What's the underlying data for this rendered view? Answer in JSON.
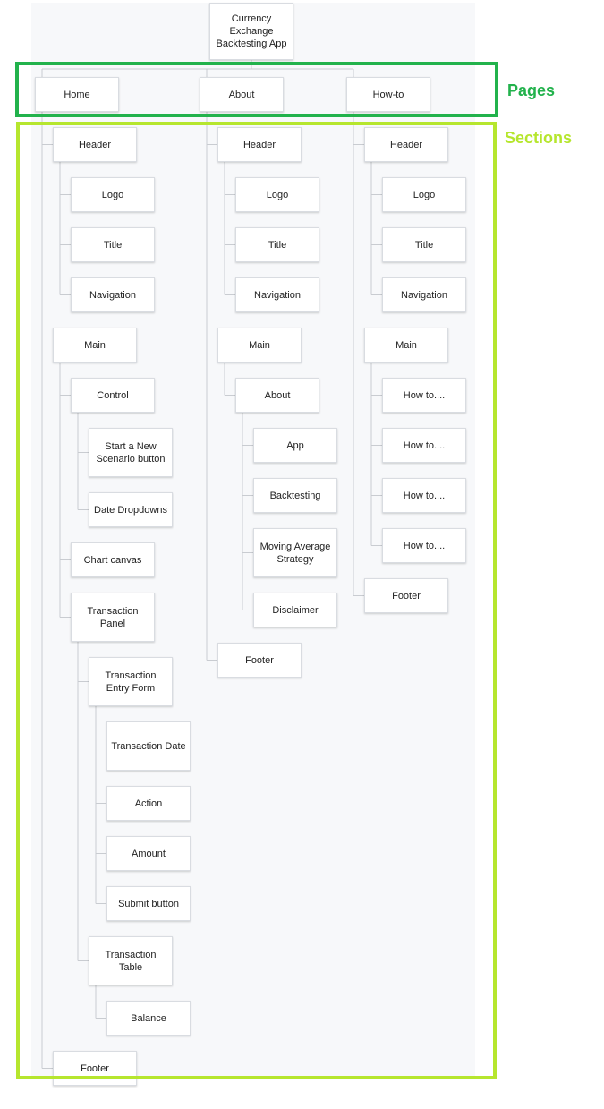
{
  "root": "Currency Exchange Backtesting App",
  "labels": {
    "pages": "Pages",
    "sections": "Sections"
  },
  "colors": {
    "pages_frame": "#22b24c",
    "sections_frame": "#b6e62e",
    "connector": "#c9ccd1",
    "node_border": "#d9dce1"
  },
  "pages": [
    {
      "name": "Home",
      "sections": [
        {
          "name": "Header",
          "children": [
            {
              "name": "Logo"
            },
            {
              "name": "Title"
            },
            {
              "name": "Navigation"
            }
          ]
        },
        {
          "name": "Main",
          "children": [
            {
              "name": "Control",
              "children": [
                {
                  "name": "Start a New Scenario button"
                },
                {
                  "name": "Date Dropdowns"
                }
              ]
            },
            {
              "name": "Chart canvas"
            },
            {
              "name": "Transaction Panel",
              "children": [
                {
                  "name": "Transaction Entry Form",
                  "children": [
                    {
                      "name": "Transaction Date"
                    },
                    {
                      "name": "Action"
                    },
                    {
                      "name": "Amount"
                    },
                    {
                      "name": "Submit button"
                    }
                  ]
                },
                {
                  "name": "Transaction Table",
                  "children": [
                    {
                      "name": "Balance"
                    }
                  ]
                }
              ]
            }
          ]
        },
        {
          "name": "Footer"
        }
      ]
    },
    {
      "name": "About",
      "sections": [
        {
          "name": "Header",
          "children": [
            {
              "name": "Logo"
            },
            {
              "name": "Title"
            },
            {
              "name": "Navigation"
            }
          ]
        },
        {
          "name": "Main",
          "children": [
            {
              "name": "About",
              "children": [
                {
                  "name": "App"
                },
                {
                  "name": "Backtesting"
                },
                {
                  "name": "Moving Average Strategy"
                },
                {
                  "name": "Disclaimer"
                }
              ]
            }
          ]
        },
        {
          "name": "Footer"
        }
      ]
    },
    {
      "name": "How-to",
      "sections": [
        {
          "name": "Header",
          "children": [
            {
              "name": "Logo"
            },
            {
              "name": "Title"
            },
            {
              "name": "Navigation"
            }
          ]
        },
        {
          "name": "Main",
          "children": [
            {
              "name": "How to...."
            },
            {
              "name": "How to...."
            },
            {
              "name": "How to...."
            },
            {
              "name": "How to...."
            }
          ]
        },
        {
          "name": "Footer"
        }
      ]
    }
  ]
}
